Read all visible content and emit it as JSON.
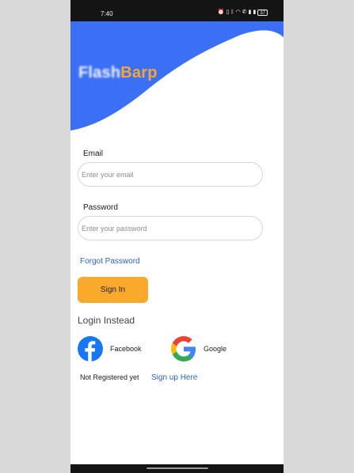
{
  "status_bar": {
    "time": "7:40",
    "battery": "37"
  },
  "logo": {
    "blurred_part": "Flash",
    "brand_part": "Barp"
  },
  "form": {
    "email_label": "Email",
    "email_placeholder": "Enter your email",
    "email_value": "",
    "password_label": "Password",
    "password_placeholder": "Enter your password",
    "password_value": "",
    "forgot_password": "Forgot Password",
    "sign_in": "Sign In"
  },
  "social": {
    "heading": "Login Instead",
    "facebook_label": "Facebook",
    "google_label": "Google"
  },
  "signup": {
    "prompt": "Not Registered yet",
    "link": "Sign up Here"
  },
  "colors": {
    "hero_blue": "#3b6ff5",
    "accent_orange": "#f9a92b",
    "link_blue": "#2d5fc8",
    "facebook_blue": "#1877f2"
  }
}
